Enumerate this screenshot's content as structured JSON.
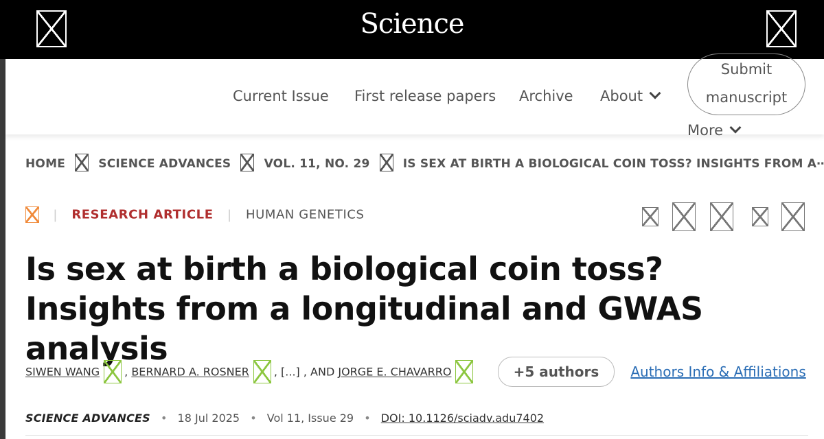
{
  "header": {
    "logo": "Science",
    "menu_icon": "broken-image-icon",
    "account_icon": "broken-image-icon"
  },
  "nav": {
    "items": [
      "Current Issue",
      "First release papers",
      "Archive",
      "About"
    ],
    "submit": [
      "Submit",
      "manuscript"
    ],
    "more": "More"
  },
  "breadcrumb": [
    "HOME",
    "SCIENCE ADVANCES",
    "VOL. 11, NO. 29",
    "IS SEX AT BIRTH A BIOLOGICAL COIN TOSS? INSIGHTS FROM A⋯"
  ],
  "article": {
    "type": "RESEARCH ARTICLE",
    "subject": "HUMAN GENETICS",
    "title": "Is sex at birth a biological coin toss? Insights from a longitudinal and GWAS analysis",
    "authors": [
      "SIWEN WANG",
      "BERNARD A. ROSNER",
      "JORGE E. CHAVARRO"
    ],
    "ellipsis": ", [...] , AND",
    "comma": ",",
    "more_authors": "+5 authors",
    "affiliations_link": "Authors Info & Affiliations",
    "journal": "SCIENCE ADVANCES",
    "date": "18 Jul 2025",
    "volume": "Vol 11, Issue 29",
    "doi": "DOI: 10.1126/sciadv.adu7402",
    "separator": "•"
  },
  "colors": {
    "header_bg": "#000000",
    "article_type": "#b02e2e",
    "link": "#2a6db5",
    "orcid": "#8cc63f",
    "access_icon": "#f08a3a"
  }
}
